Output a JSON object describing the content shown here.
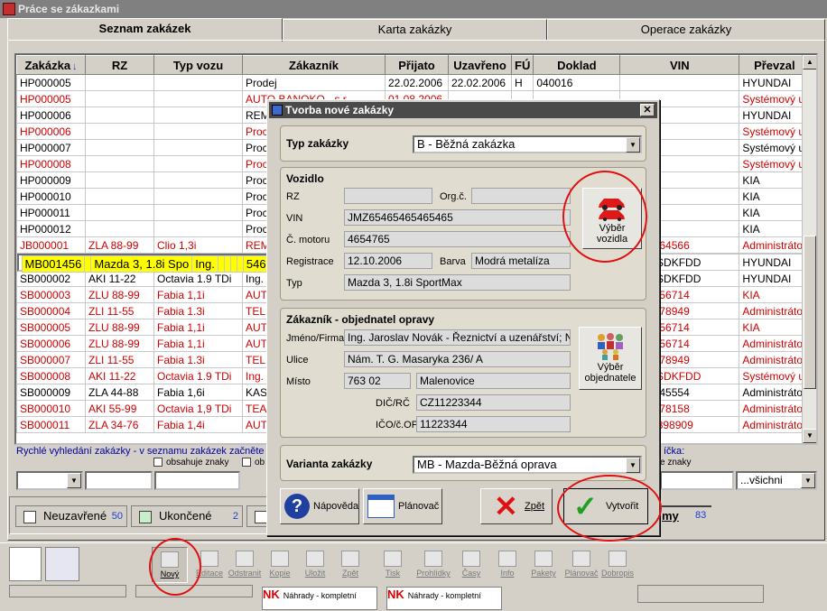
{
  "window": {
    "title": "Práce se zákazkami"
  },
  "tabs": [
    {
      "label": "Seznam zakázek"
    },
    {
      "label": "Karta zakázky"
    },
    {
      "label": "Operace zakázky"
    }
  ],
  "grid": {
    "columns": [
      "Zakázka",
      "RZ",
      "Typ vozu",
      "Zákazník",
      "Přijato",
      "Uzavřeno",
      "FÚ",
      "Doklad",
      "VIN",
      "Převzal"
    ],
    "rows": [
      {
        "c": [
          "HP000005",
          "",
          "",
          "Prodej",
          "22.02.2006",
          "22.02.2006",
          "H",
          "040016",
          "",
          "HYUNDAI"
        ],
        "s": ""
      },
      {
        "c": [
          "HP000005",
          "",
          "",
          "AUTO BANOKO - s.r.",
          "01.08.2006",
          "",
          "",
          "",
          "",
          "Systémový u"
        ],
        "s": "red"
      },
      {
        "c": [
          "HP000006",
          "",
          "",
          "REM",
          "",
          "",
          "",
          "",
          "",
          "HYUNDAI"
        ],
        "s": ""
      },
      {
        "c": [
          "HP000006",
          "",
          "",
          "Proc",
          "",
          "",
          "",
          "",
          "",
          "Systémový u"
        ],
        "s": "red"
      },
      {
        "c": [
          "HP000007",
          "",
          "",
          "Proc",
          "",
          "",
          "",
          "",
          "",
          "Systémový u"
        ],
        "s": ""
      },
      {
        "c": [
          "HP000008",
          "",
          "",
          "Proc",
          "",
          "",
          "",
          "",
          "",
          "Systémový u"
        ],
        "s": "red"
      },
      {
        "c": [
          "HP000009",
          "",
          "",
          "Proc",
          "",
          "",
          "",
          "",
          "",
          "KIA"
        ],
        "s": ""
      },
      {
        "c": [
          "HP000010",
          "",
          "",
          "Proc",
          "",
          "",
          "",
          "",
          "",
          "KIA"
        ],
        "s": ""
      },
      {
        "c": [
          "HP000011",
          "",
          "",
          "Proc",
          "",
          "",
          "",
          "",
          "",
          "KIA"
        ],
        "s": ""
      },
      {
        "c": [
          "HP000012",
          "",
          "",
          "Proc",
          "",
          "",
          "",
          "",
          "",
          "KIA"
        ],
        "s": ""
      },
      {
        "c": [
          "JB000001",
          "ZLA 88-99",
          "Clio 1,3i",
          "REM",
          "",
          "",
          "",
          "",
          "54564564566",
          "Administrátor"
        ],
        "s": "red"
      },
      {
        "c": [
          "MB001456",
          "",
          "Mazda 3, 1.8i Spo",
          "Ing.",
          "",
          "",
          "",
          "",
          "5465465465",
          "Systémový u"
        ],
        "s": "sel"
      },
      {
        "c": [
          "SB000001",
          "AKI 11-22",
          "Octavia 1.9 TDi",
          "Ing.",
          "",
          "",
          "",
          "",
          "DFJLASDKFDD",
          "HYUNDAI"
        ],
        "s": ""
      },
      {
        "c": [
          "SB000002",
          "AKI 11-22",
          "Octavia 1.9 TDi",
          "Ing.",
          "",
          "",
          "",
          "",
          "DFJLASDKFDD",
          "HYUNDAI"
        ],
        "s": ""
      },
      {
        "c": [
          "SB000003",
          "ZLU 88-99",
          "Fabia 1,1i",
          "AUT",
          "",
          "",
          "",
          "",
          "00123456714",
          "KIA"
        ],
        "s": "red"
      },
      {
        "c": [
          "SB000004",
          "ZLI 11-55",
          "Fabia 1.3i",
          "TELE",
          "",
          "",
          "",
          "",
          "78945678949",
          "Administrátor"
        ],
        "s": "red"
      },
      {
        "c": [
          "SB000005",
          "ZLU 88-99",
          "Fabia 1,1i",
          "AUT",
          "",
          "",
          "",
          "",
          "00123456714",
          "KIA"
        ],
        "s": "red"
      },
      {
        "c": [
          "SB000006",
          "ZLU 88-99",
          "Fabia 1,1i",
          "AUT",
          "",
          "",
          "",
          "",
          "00123456714",
          "Administrátor"
        ],
        "s": "red"
      },
      {
        "c": [
          "SB000007",
          "ZLI 11-55",
          "Fabia 1.3i",
          "TELE",
          "",
          "",
          "",
          "",
          "78945678949",
          "Administrátor"
        ],
        "s": "red"
      },
      {
        "c": [
          "SB000008",
          "AKI 11-22",
          "Octavia 1.9 TDi",
          "Ing.",
          "",
          "",
          "",
          "",
          "DFJLASDKFDD",
          "Systémový u"
        ],
        "s": "red"
      },
      {
        "c": [
          "SB000009",
          "ZLA 44-88",
          "Fabia 1,6i",
          "KAS",
          "",
          "",
          "",
          "",
          "46546545554",
          "Administrátor"
        ],
        "s": ""
      },
      {
        "c": [
          "SB000010",
          "AKI 55-99",
          "Octavia 1,9 TDi",
          "TEA",
          "",
          "",
          "",
          "",
          "12345678158",
          "Administrátor"
        ],
        "s": "red"
      },
      {
        "c": [
          "SB000011",
          "ZLA 34-76",
          "Fabia 1,4i",
          "AUT",
          "",
          "",
          "",
          "",
          "9Q37E898909",
          "Administrátor"
        ],
        "s": "red"
      }
    ]
  },
  "search": {
    "hint": "Rychlé vyhledání zakázky - v seznamu zakázek začněte p",
    "hint_tail": "íčka:",
    "contains_label": "obsahuje znaky",
    "contains_label_short": "ob",
    "contains_label_right": "e znaky",
    "filter_value": "...všichni"
  },
  "legend": [
    {
      "label": "Neuzavřené",
      "count": "50",
      "color": "#ffffff"
    },
    {
      "label": "Ukončené",
      "count": "2",
      "color": "#c8f0c8"
    }
  ],
  "legend_right": {
    "label": "my",
    "count": "83"
  },
  "toolbar": [
    {
      "label": "Nový",
      "active": true
    },
    {
      "label": "Editace"
    },
    {
      "label": "Odstranit"
    },
    {
      "label": "Kopie"
    },
    {
      "label": "Uložit"
    },
    {
      "label": "Zpět"
    },
    {
      "label": "Tisk"
    },
    {
      "label": "Prohlídky"
    },
    {
      "label": "Časy"
    },
    {
      "label": "Info"
    },
    {
      "label": "Pakety"
    },
    {
      "label": "Plánovač"
    },
    {
      "label": "Dobropis"
    }
  ],
  "bottom_cards": [
    {
      "nk": "NK",
      "text": "Náhrady - kompletní"
    },
    {
      "nk": "NK",
      "text": "Náhrady - kompletní"
    }
  ],
  "dialog": {
    "title": "Tvorba nové zakázky",
    "typ_label": "Typ zakázky",
    "typ_value": "B - Běžná zakázka",
    "vozidlo": {
      "title": "Vozidlo",
      "rz_label": "RZ",
      "rz": "",
      "org_label": "Org.č.",
      "org": "",
      "vin_label": "VIN",
      "vin": "JMZ65465465465465",
      "motor_label": "Č. motoru",
      "motor": "4654765",
      "reg_label": "Registrace",
      "reg": "12.10.2006",
      "barva_label": "Barva",
      "barva": "Modrá metalíza",
      "typ_label": "Typ",
      "typ": "Mazda 3, 1.8i SportMax",
      "pick_label1": "Výběr",
      "pick_label2": "vozidla"
    },
    "zakaznik": {
      "title": "Zákazník - objednatel opravy",
      "jmeno_label": "Jméno/Firma",
      "jmeno": "Ing. Jaroslav Novák - Řeznictví a uzenářství; N",
      "ulice_label": "Ulice",
      "ulice": "Nám. T. G. Masaryka 236/ A",
      "misto_label": "Místo",
      "psc": "763 02",
      "mesto": "Malenovice",
      "dic_label": "DIČ/RČ",
      "dic": "CZ11223344",
      "ico_label": "IČO/č.OP",
      "ico": "11223344",
      "pick_label1": "Výběr",
      "pick_label2": "objednatele"
    },
    "varianta_label": "Varianta zakázky",
    "varianta_value": "MB - Mazda-Běžná oprava",
    "buttons": {
      "help": "Nápověda",
      "planner": "Plánovač",
      "back": "Zpět",
      "create": "Vytvořit"
    }
  }
}
